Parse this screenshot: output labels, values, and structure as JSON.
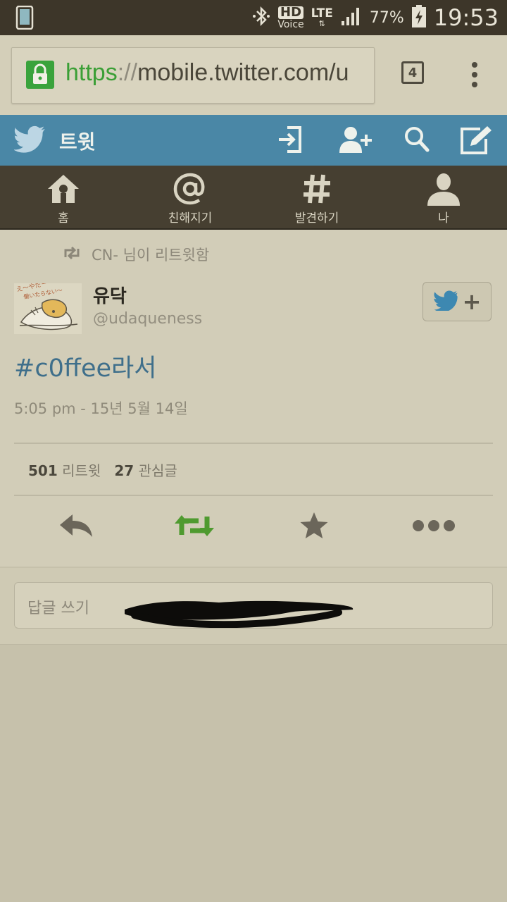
{
  "status_bar": {
    "hd_label": "HD",
    "voice_label": "Voice",
    "lte_label": "LTE",
    "lte_arrows": "⇅",
    "battery": "77%",
    "time": "19:53"
  },
  "browser": {
    "url_scheme": "https",
    "url_sep": "://",
    "url_rest": "mobile.twitter.com/u",
    "tab_count": "4"
  },
  "header": {
    "title": "트윗"
  },
  "nav": [
    {
      "label": "홈",
      "icon": "home-icon"
    },
    {
      "label": "친해지기",
      "icon": "at-icon"
    },
    {
      "label": "발견하기",
      "icon": "hashtag-icon"
    },
    {
      "label": "나",
      "icon": "person-icon"
    }
  ],
  "tweet": {
    "retweet_note": "CN- 님이 리트윗함",
    "user_name": "유닥",
    "user_handle": "@udaqueness",
    "text": "#c0ffee라서",
    "timestamp": "5:05 pm - 15년 5월 14일",
    "retweet_count": "501",
    "retweet_label": "리트윗",
    "favorite_count": "27",
    "favorite_label": "관심글",
    "avatar_caption": "え〜やだー 働いたらない〜"
  },
  "reply": {
    "placeholder": "답글 쓰기"
  },
  "colors": {
    "twitter_header": "#4a87a6",
    "nav_bg": "#463f31",
    "hashtag": "#3f6f8b",
    "retweet_green": "#4f9a2f",
    "url_green": "#3b9f36"
  }
}
